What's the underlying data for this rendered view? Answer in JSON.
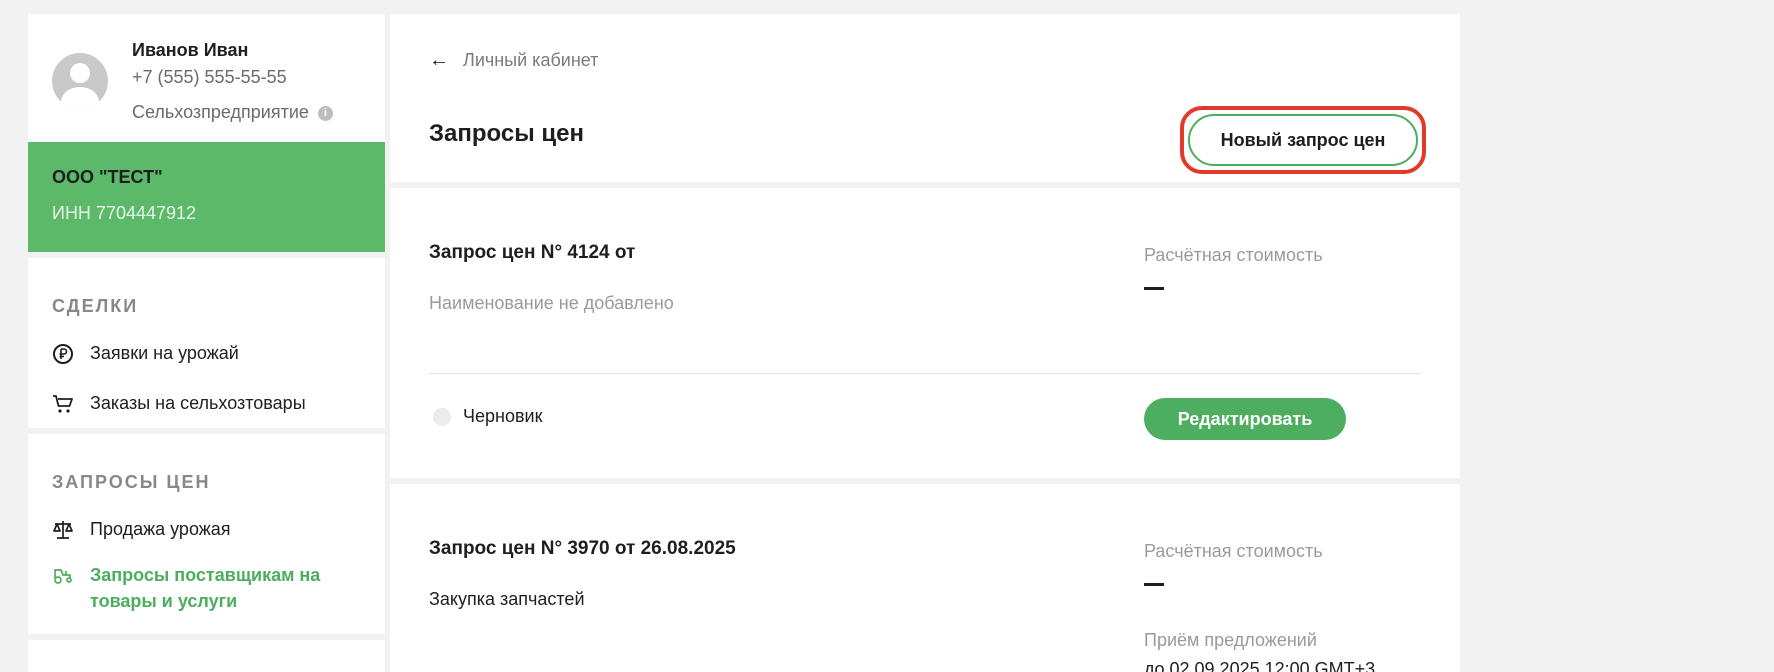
{
  "profile": {
    "name": "Иванов Иван",
    "phone": "+7 (555) 555-55-55",
    "type": "Сельхозпредприятие",
    "info_glyph": "i"
  },
  "company": {
    "name": "ООО \"ТЕСТ\"",
    "inn": "ИНН 7704447912"
  },
  "nav": {
    "deals_heading": "СДЕЛКИ",
    "deals_items": [
      {
        "label": "Заявки на урожай",
        "icon": "ruble-icon"
      },
      {
        "label": "Заказы на сельхозтовары",
        "icon": "cart-icon"
      }
    ],
    "requests_heading": "ЗАПРОСЫ ЦЕН",
    "requests_items": [
      {
        "label": "Продажа урожая",
        "icon": "scales-icon"
      },
      {
        "label": "Запросы поставщикам на товары и услуги",
        "icon": "tractor-icon",
        "active": true
      }
    ]
  },
  "header": {
    "back_label": "Личный кабинет",
    "back_arrow": "←",
    "title": "Запросы цен",
    "new_request_label": "Новый запрос цен"
  },
  "requests": [
    {
      "title": "Запрос цен N° 4124 от",
      "description": "Наименование не добавлено",
      "cost_label": "Расчётная стоимость",
      "status": "Черновик",
      "action_label": "Редактировать"
    },
    {
      "title": "Запрос цен N° 3970 от 26.08.2025",
      "description": "Закупка запчастей",
      "cost_label": "Расчётная стоимость",
      "deadline_label": "Приём предложений",
      "deadline_value": "до 02.09.2025 12:00 GMT+3"
    }
  ],
  "colors": {
    "accent_green": "#4cae5e",
    "company_bg": "#5cb96a",
    "highlight_red": "#e03a2a"
  }
}
